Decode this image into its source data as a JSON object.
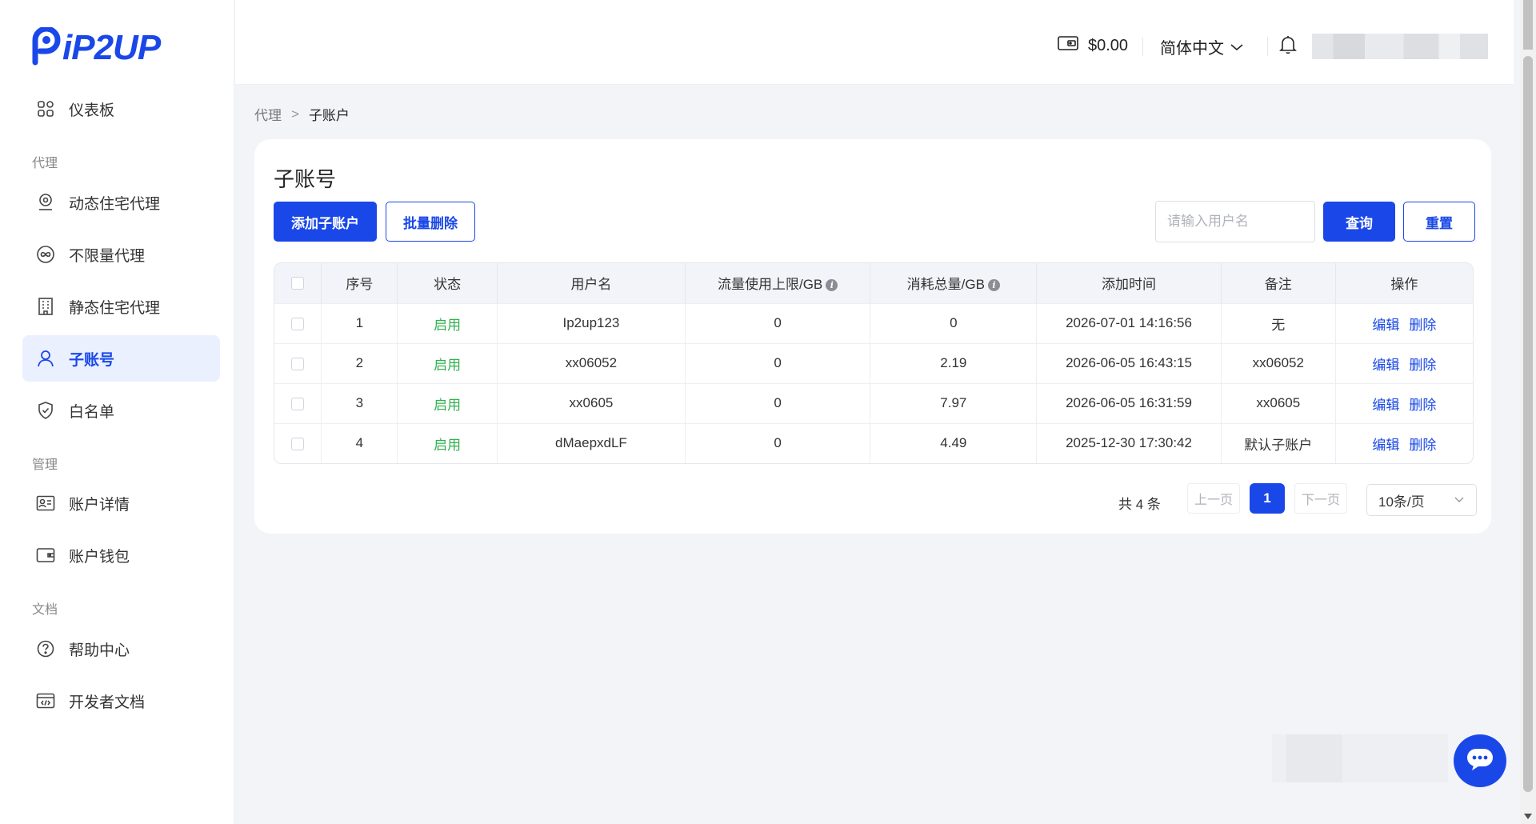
{
  "brand": {
    "logo_text": "iP2UP"
  },
  "sidebar": {
    "items": [
      {
        "label": "仪表板",
        "icon": "dashboard-icon"
      },
      {
        "label": "动态住宅代理",
        "icon": "location-pin-icon"
      },
      {
        "label": "不限量代理",
        "icon": "infinity-icon"
      },
      {
        "label": "静态住宅代理",
        "icon": "building-icon"
      },
      {
        "label": "子账号",
        "icon": "user-icon",
        "active": true
      },
      {
        "label": "白名单",
        "icon": "shield-icon"
      },
      {
        "label": "账户详情",
        "icon": "id-card-icon"
      },
      {
        "label": "账户钱包",
        "icon": "wallet-icon"
      },
      {
        "label": "帮助中心",
        "icon": "help-circle-icon"
      },
      {
        "label": "开发者文档",
        "icon": "code-doc-icon"
      }
    ],
    "sections": {
      "proxy": "代理",
      "manage": "管理",
      "docs": "文档"
    }
  },
  "header": {
    "balance": "$0.00",
    "language": "简体中文"
  },
  "breadcrumb": {
    "parent": "代理",
    "separator": ">",
    "current": "子账户"
  },
  "main": {
    "title": "子账号",
    "add_button": "添加子账户",
    "batch_delete_button": "批量删除",
    "search_placeholder": "请输入用户名",
    "query_button": "查询",
    "reset_button": "重置",
    "table": {
      "columns": [
        "序号",
        "状态",
        "用户名",
        "流量使用上限/GB",
        "消耗总量/GB",
        "添加时间",
        "备注",
        "操作"
      ],
      "rows": [
        {
          "index": "1",
          "status": "启用",
          "username": "Ip2up123",
          "limit": "0",
          "used": "0",
          "created": "2026-07-01 14:16:56",
          "remark": "无"
        },
        {
          "index": "2",
          "status": "启用",
          "username": "xx06052",
          "limit": "0",
          "used": "2.19",
          "created": "2026-06-05 16:43:15",
          "remark": "xx06052"
        },
        {
          "index": "3",
          "status": "启用",
          "username": "xx0605",
          "limit": "0",
          "used": "7.97",
          "created": "2026-06-05 16:31:59",
          "remark": "xx0605"
        },
        {
          "index": "4",
          "status": "启用",
          "username": "dMaepxdLF",
          "limit": "0",
          "used": "4.49",
          "created": "2025-12-30 17:30:42",
          "remark": "默认子账户"
        }
      ],
      "actions": {
        "edit": "编辑",
        "delete": "删除"
      }
    },
    "pagination": {
      "total": "共 4 条",
      "prev": "上一页",
      "current": "1",
      "next": "下一页",
      "page_size": "10条/页"
    }
  },
  "colors": {
    "primary": "#1a48e8",
    "status_green": "#2fb14f",
    "bg": "#f2f4f8"
  }
}
